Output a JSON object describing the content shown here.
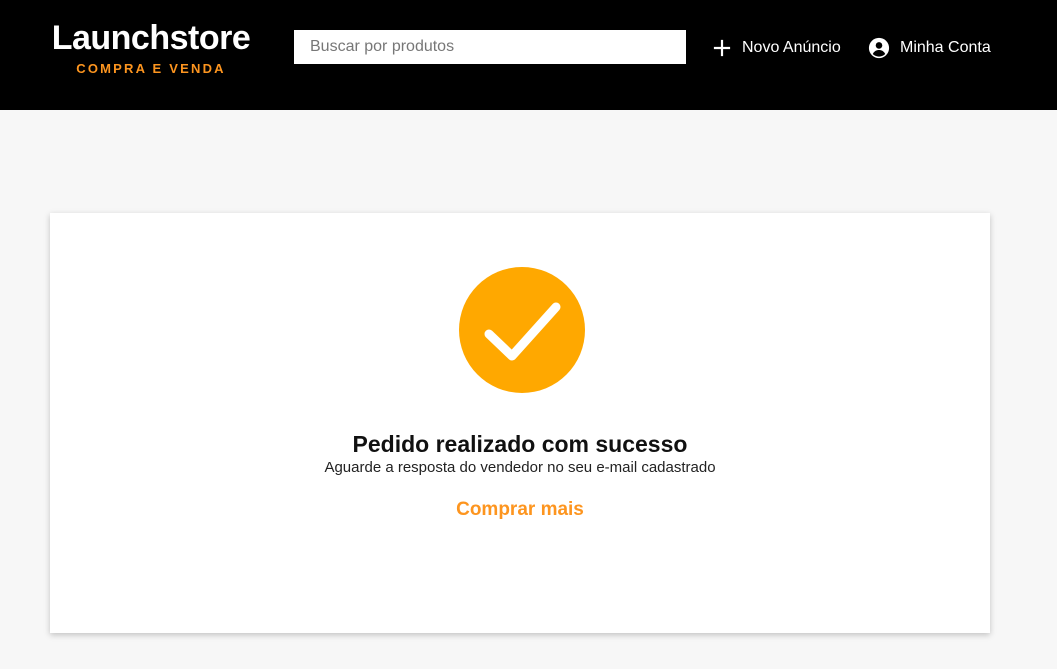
{
  "header": {
    "logo_title": "Launchstore",
    "logo_subtitle": "COMPRA E VENDA",
    "search_placeholder": "Buscar por produtos",
    "search_value": "",
    "new_ad_label": "Novo Anúncio",
    "new_ad_icon": "plus-icon",
    "account_label": "Minha Conta",
    "account_icon": "account-circle-icon"
  },
  "success": {
    "icon": "check-circle-icon",
    "title": "Pedido realizado com sucesso",
    "subtitle": "Aguarde a resposta do vendedor no seu e-mail cadastrado",
    "link_label": "Comprar mais"
  },
  "colors": {
    "header_bg": "#000000",
    "accent": "#fd951f",
    "check_circle": "#ffa800",
    "page_bg": "#f7f7f7",
    "card_bg": "#ffffff"
  }
}
